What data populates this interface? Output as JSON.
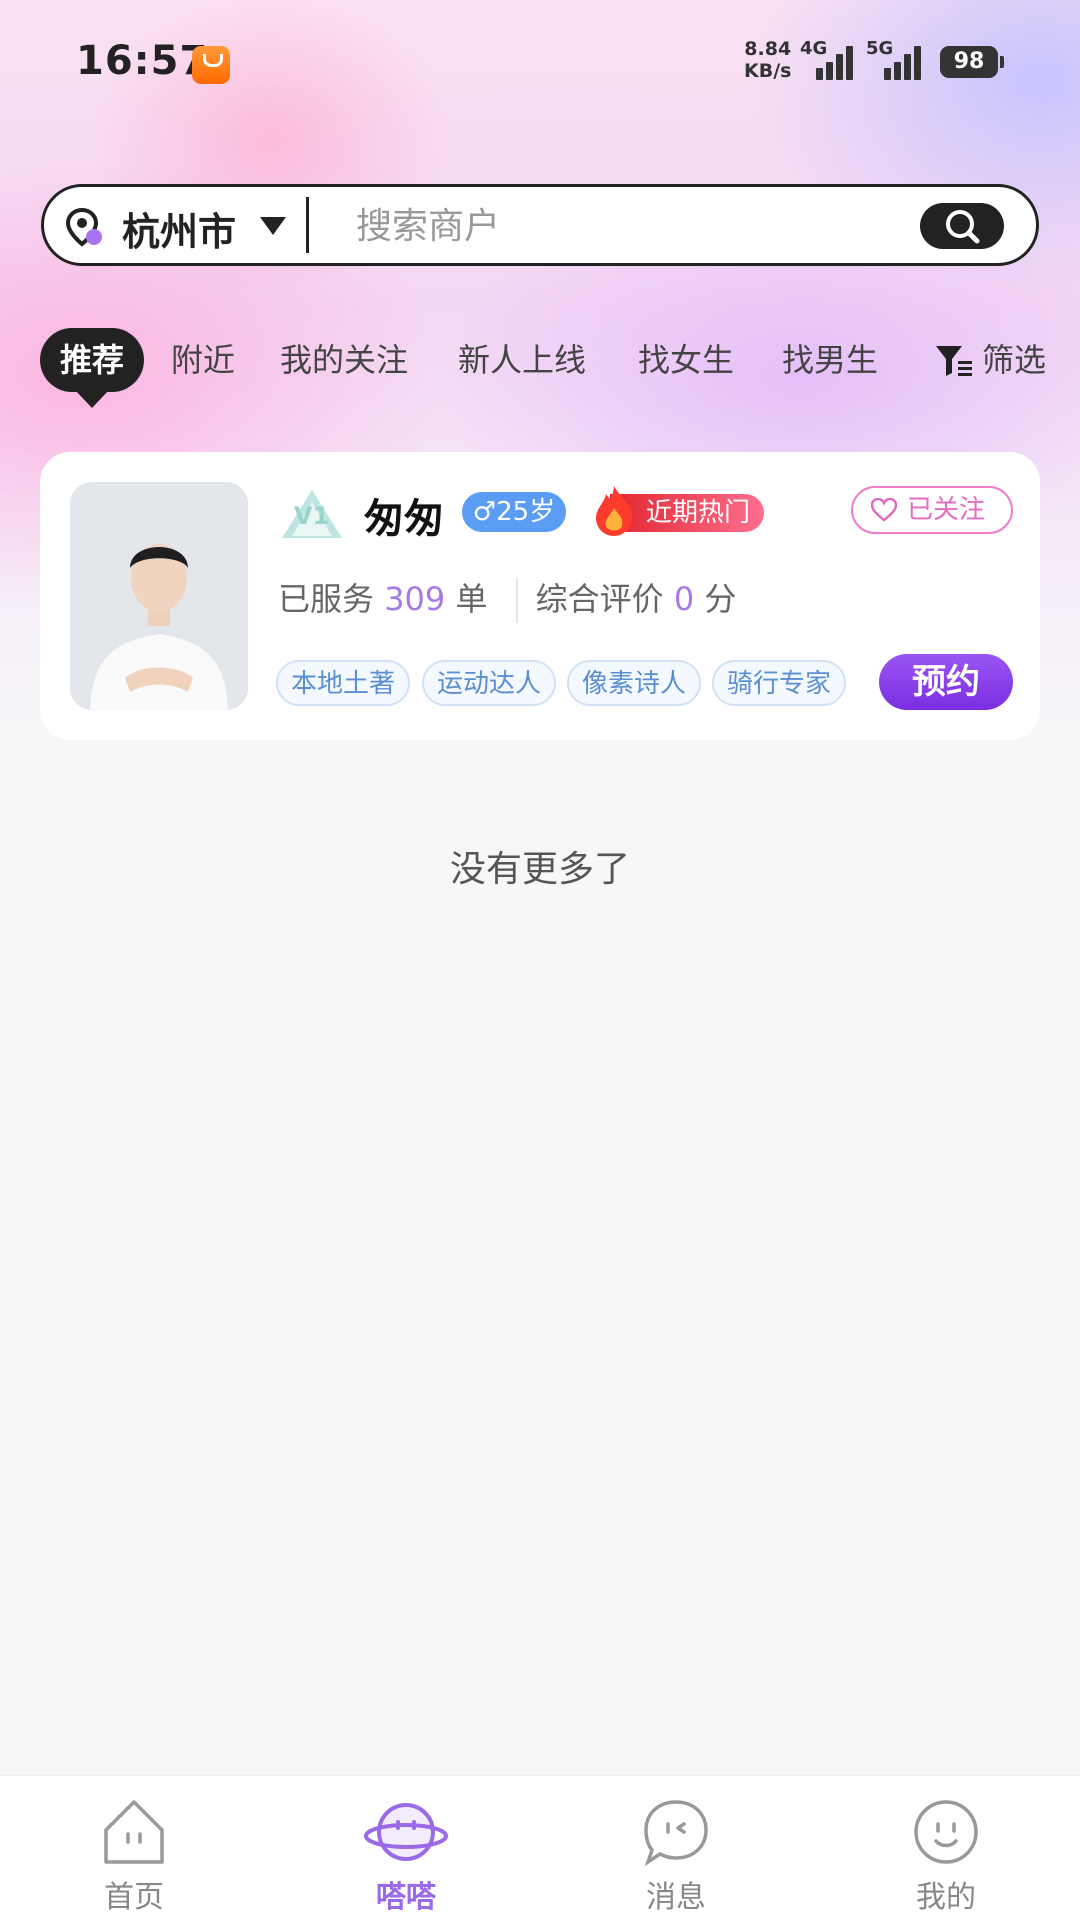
{
  "status_bar": {
    "time": "16:57",
    "net_speed_value": "8.84",
    "net_speed_unit": "KB/s",
    "net_4g": "4G",
    "net_5g": "5G",
    "battery": "98"
  },
  "search": {
    "city": "杭州市",
    "placeholder": "搜索商户"
  },
  "tabs": [
    {
      "label": "推荐",
      "active": true
    },
    {
      "label": "附近"
    },
    {
      "label": "我的关注"
    },
    {
      "label": "新人上线"
    },
    {
      "label": "找女生"
    },
    {
      "label": "找男生"
    }
  ],
  "filter": {
    "label": "筛选",
    "icon": "filter-icon"
  },
  "card": {
    "level": "V1",
    "name": "匆匆",
    "gender_symbol": "♂",
    "age": "25岁",
    "hot_label": "近期热门",
    "follow_label": "已关注",
    "served_prefix": "已服务",
    "served_count": "309",
    "served_unit": "单",
    "rating_prefix": "综合评价",
    "rating_value": "0",
    "rating_unit": "分",
    "tags": [
      "本地土著",
      "运动达人",
      "像素诗人",
      "骑行专家"
    ],
    "book_label": "预约"
  },
  "end_text": "没有更多了",
  "bottom_nav": [
    {
      "label": "首页",
      "icon": "home-icon"
    },
    {
      "label": "嗒嗒",
      "icon": "planet-icon",
      "active": true
    },
    {
      "label": "消息",
      "icon": "message-icon"
    },
    {
      "label": "我的",
      "icon": "profile-icon"
    }
  ],
  "colors": {
    "accent_purple": "#9b6ae6",
    "book_button": "#8a3fea",
    "age_badge": "#5b9cf4",
    "hot_tag": "#e0262e",
    "follow_pink": "#e46cc0",
    "tag_blue": "#5b8fd2"
  }
}
